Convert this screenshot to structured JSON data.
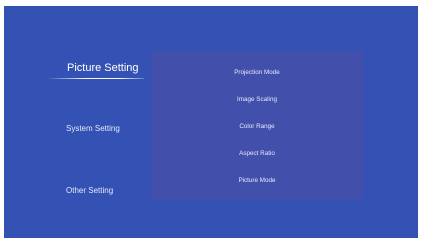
{
  "sidebar": {
    "items": [
      {
        "label": "Picture Setting"
      },
      {
        "label": "System Setting"
      },
      {
        "label": "Other Setting"
      }
    ]
  },
  "submenu": {
    "items": [
      {
        "label": "Projection Mode"
      },
      {
        "label": "Image Scaling"
      },
      {
        "label": "Color Range"
      },
      {
        "label": "Aspect Ratio"
      },
      {
        "label": "Picture Mode"
      }
    ]
  },
  "colors": {
    "background": "#3452b4",
    "panel": "#4250ac",
    "text": "#e6eafb"
  }
}
